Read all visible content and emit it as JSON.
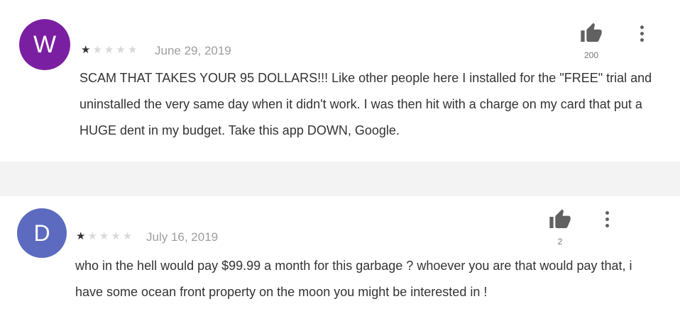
{
  "reviews": [
    {
      "avatar_letter": "W",
      "avatar_color": "#7b1fa2",
      "rating": 1,
      "date": "June 29, 2019",
      "text": "SCAM THAT TAKES YOUR 95 DOLLARS!!! Like other people here I installed for the \"FREE\" trial and uninstalled the very same day when it didn't work. I was then hit with a charge on my card that put a HUGE dent in my budget. Take this app DOWN, Google.",
      "helpful_count": "200"
    },
    {
      "avatar_letter": "D",
      "avatar_color": "#5c6bc0",
      "rating": 1,
      "date": "July 16, 2019",
      "text": "who in the hell would pay $99.99 a month for this garbage ? whoever you are that would pay that, i have some ocean front property on the moon you might be interested in !",
      "helpful_count": "2"
    }
  ],
  "icons": {
    "thumb": "thumbs-up-icon",
    "more": "more-vert-icon",
    "star": "star-icon"
  }
}
